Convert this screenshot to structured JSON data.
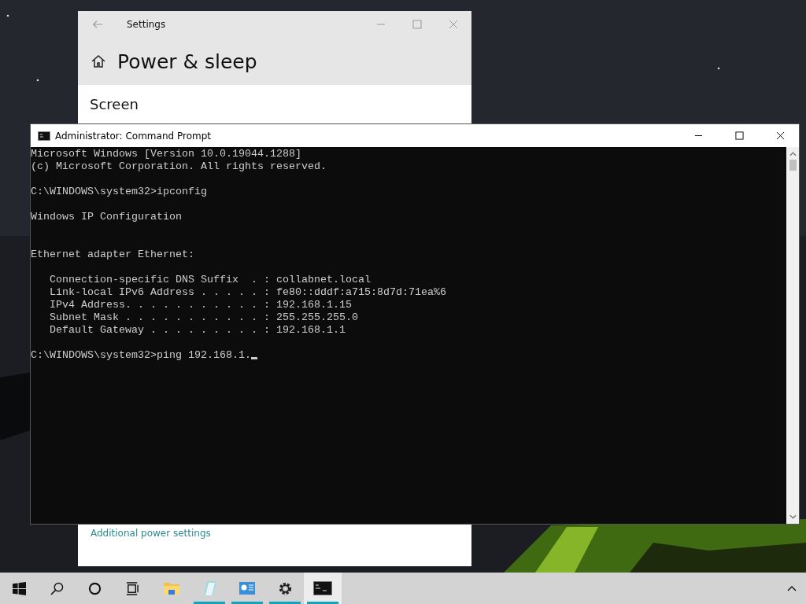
{
  "settings_window": {
    "title": "Settings",
    "heading": "Power & sleep",
    "section": "Screen",
    "link": "Additional power settings"
  },
  "console_window": {
    "title": "Administrator: Command Prompt",
    "output": "Microsoft Windows [Version 10.0.19044.1288]\n(c) Microsoft Corporation. All rights reserved.\n\nC:\\WINDOWS\\system32>ipconfig\n\nWindows IP Configuration\n\n\nEthernet adapter Ethernet:\n\n   Connection-specific DNS Suffix  . : collabnet.local\n   Link-local IPv6 Address . . . . . : fe80::dddf:a715:8d7d:71ea%6\n   IPv4 Address. . . . . . . . . . . : 192.168.1.15\n   Subnet Mask . . . . . . . . . . . : 255.255.255.0\n   Default Gateway . . . . . . . . . : 192.168.1.1",
    "prompt": "C:\\WINDOWS\\system32>ping 192.168.1."
  },
  "taskbar": {
    "items": [
      {
        "kind": "start",
        "running": false,
        "selected": false
      },
      {
        "kind": "search",
        "running": false,
        "selected": false
      },
      {
        "kind": "cortana",
        "running": false,
        "selected": false
      },
      {
        "kind": "taskview",
        "running": false,
        "selected": false
      },
      {
        "kind": "explorer",
        "running": false,
        "selected": false
      },
      {
        "kind": "notepad",
        "running": true,
        "selected": false
      },
      {
        "kind": "panel",
        "running": true,
        "selected": false
      },
      {
        "kind": "settings",
        "running": true,
        "selected": false
      },
      {
        "kind": "console",
        "running": true,
        "selected": true
      }
    ]
  }
}
